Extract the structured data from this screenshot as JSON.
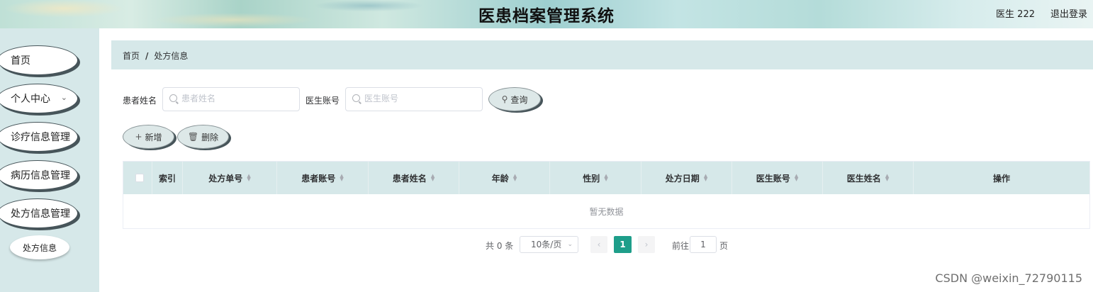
{
  "header": {
    "title": "医患档案管理系统",
    "user": "医生 222",
    "logout": "退出登录"
  },
  "sidebar": {
    "items": [
      {
        "label": "首页"
      },
      {
        "label": "个人中心",
        "chevron": "chevron-down-icon"
      },
      {
        "label": "诊疗信息管理"
      },
      {
        "label": "病历信息管理"
      },
      {
        "label": "处方信息管理"
      }
    ],
    "sub_item": "处方信息"
  },
  "breadcrumb": {
    "home": "首页",
    "separator": "/",
    "current": "处方信息"
  },
  "search": {
    "patient_name_label": "患者姓名",
    "patient_name_placeholder": "患者姓名",
    "doctor_account_label": "医生账号",
    "doctor_account_placeholder": "医生账号",
    "query_button": "查询"
  },
  "actions": {
    "add": "新增",
    "delete": "删除"
  },
  "table": {
    "columns": [
      "索引",
      "处方单号",
      "患者账号",
      "患者姓名",
      "年龄",
      "性别",
      "处方日期",
      "医生账号",
      "医生姓名",
      "操作"
    ],
    "empty_text": "暂无数据"
  },
  "pagination": {
    "total": "共 0 条",
    "page_size": "10条/页",
    "current_page": "1",
    "goto_label": "前往",
    "goto_value": "1",
    "page_suffix": "页"
  },
  "watermark": "CSDN @weixin_72790115",
  "colors": {
    "accent": "#1e9e8a",
    "panel": "#d6e8e9"
  }
}
